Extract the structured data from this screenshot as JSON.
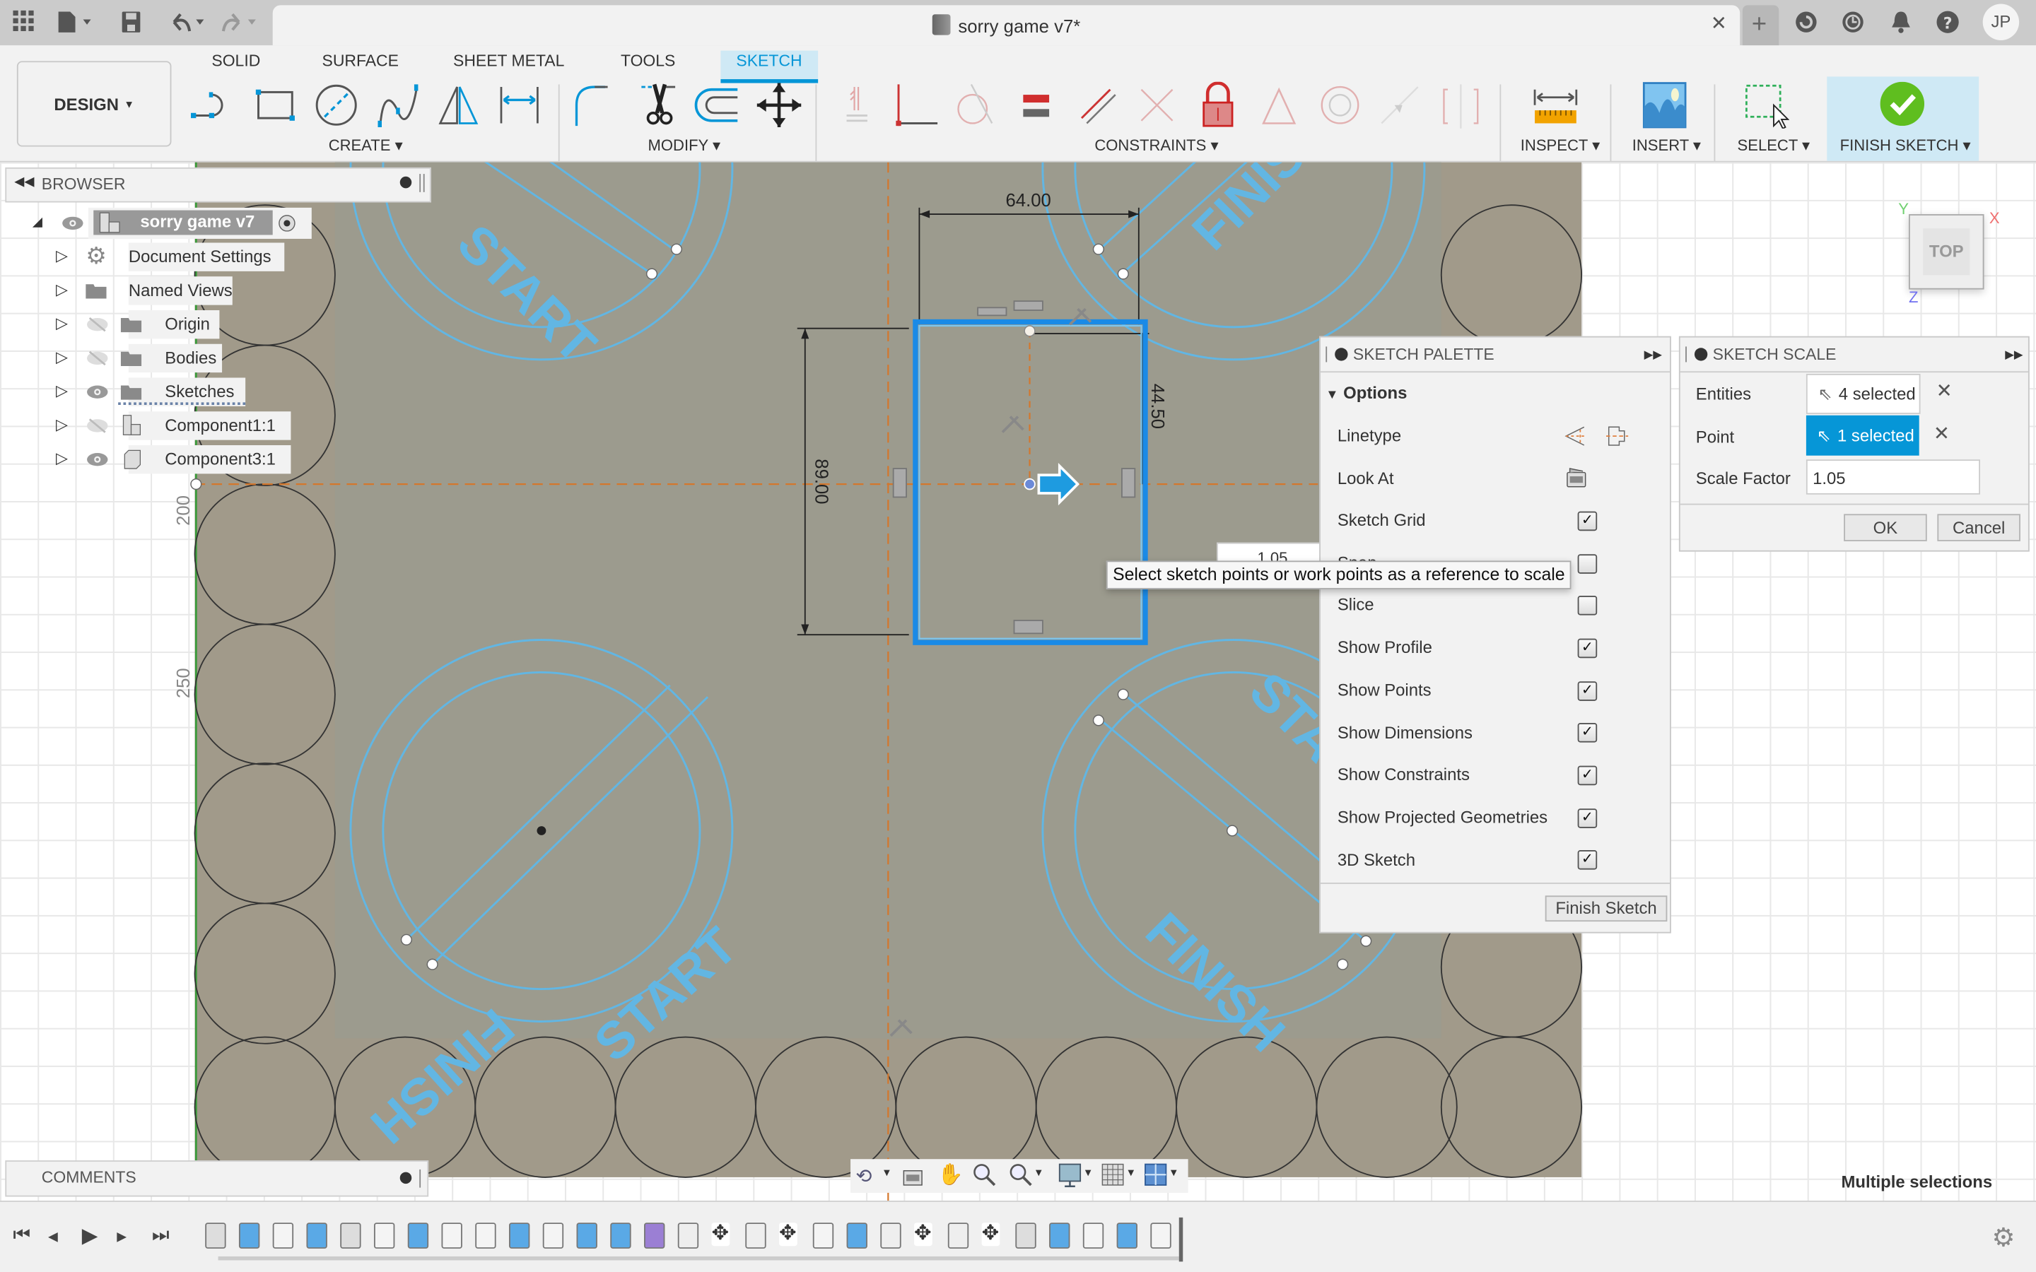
{
  "window": {
    "document_title": "sorry game v7*",
    "user_initials": "JP"
  },
  "toolbar": {
    "workspace_label": "DESIGN",
    "tabs": [
      {
        "label": "SOLID",
        "active": false
      },
      {
        "label": "SURFACE",
        "active": false
      },
      {
        "label": "SHEET METAL",
        "active": false
      },
      {
        "label": "TOOLS",
        "active": false
      },
      {
        "label": "SKETCH",
        "active": true
      }
    ],
    "groups": {
      "create": "CREATE",
      "modify": "MODIFY",
      "constraints": "CONSTRAINTS",
      "inspect": "INSPECT",
      "insert": "INSERT",
      "select": "SELECT",
      "finish": "FINISH SKETCH"
    },
    "create_tools": [
      "line-icon",
      "rectangle-icon",
      "circle-icon",
      "spline-icon",
      "mirror-icon",
      "sketch-dimension-icon"
    ],
    "modify_tools": [
      "fillet-icon",
      "trim-icon",
      "offset-icon",
      "move-icon"
    ],
    "constraint_tools": [
      "coincident-icon",
      "perpendicular-icon",
      "tangent-icon",
      "equal-icon",
      "parallel-icon",
      "collinear-icon",
      "fix-icon",
      "midpoint-icon",
      "concentric-icon",
      "horizontal-vertical-icon",
      "symmetric-icon"
    ]
  },
  "browser": {
    "title": "BROWSER",
    "root": "sorry game v7",
    "items": [
      {
        "label": "Document Settings",
        "icon": "gear-icon",
        "visible": null
      },
      {
        "label": "Named Views",
        "icon": "folder-icon",
        "visible": null
      },
      {
        "label": "Origin",
        "icon": "folder-icon",
        "visible": false
      },
      {
        "label": "Bodies",
        "icon": "folder-icon",
        "visible": false
      },
      {
        "label": "Sketches",
        "icon": "folder-icon",
        "visible": true
      },
      {
        "label": "Component1:1",
        "icon": "component-icon",
        "visible": false
      },
      {
        "label": "Component3:1",
        "icon": "body-icon",
        "visible": true
      }
    ]
  },
  "canvas": {
    "dimensions": {
      "width": "64.00",
      "height": "89.00",
      "half_height": "44.50"
    },
    "ruler_labels": [
      "200",
      "250"
    ],
    "inline_scale_value": "1.05",
    "board_labels": [
      "START",
      "FINISH"
    ],
    "view_cube": {
      "face": "TOP",
      "axes": [
        "X",
        "Y",
        "Z"
      ]
    },
    "tooltip": "Select sketch points or work points as a reference to scale"
  },
  "sketch_palette": {
    "title": "SKETCH PALETTE",
    "section": "Options",
    "rows": [
      {
        "label": "Linetype",
        "type": "icons"
      },
      {
        "label": "Look At",
        "type": "icon"
      },
      {
        "label": "Sketch Grid",
        "type": "checkbox",
        "checked": true
      },
      {
        "label": "Snap",
        "type": "checkbox",
        "checked": false
      },
      {
        "label": "Slice",
        "type": "checkbox",
        "checked": false
      },
      {
        "label": "Show Profile",
        "type": "checkbox",
        "checked": true
      },
      {
        "label": "Show Points",
        "type": "checkbox",
        "checked": true
      },
      {
        "label": "Show Dimensions",
        "type": "checkbox",
        "checked": true
      },
      {
        "label": "Show Constraints",
        "type": "checkbox",
        "checked": true
      },
      {
        "label": "Show Projected Geometries",
        "type": "checkbox",
        "checked": true
      },
      {
        "label": "3D Sketch",
        "type": "checkbox",
        "checked": true
      }
    ],
    "finish_button": "Finish Sketch"
  },
  "sketch_scale": {
    "title": "SKETCH SCALE",
    "entities_label": "Entities",
    "entities_value": "4 selected",
    "point_label": "Point",
    "point_value": "1 selected",
    "scale_factor_label": "Scale Factor",
    "scale_factor_value": "1.05",
    "ok_label": "OK",
    "cancel_label": "Cancel"
  },
  "comments": {
    "title": "COMMENTS"
  },
  "status": {
    "text": "Multiple selections"
  },
  "colors": {
    "accent": "#0696d7",
    "sketch_blue": "#62b6e3",
    "construction_orange": "#d4772c",
    "finish_green": "#5fbe1f"
  }
}
